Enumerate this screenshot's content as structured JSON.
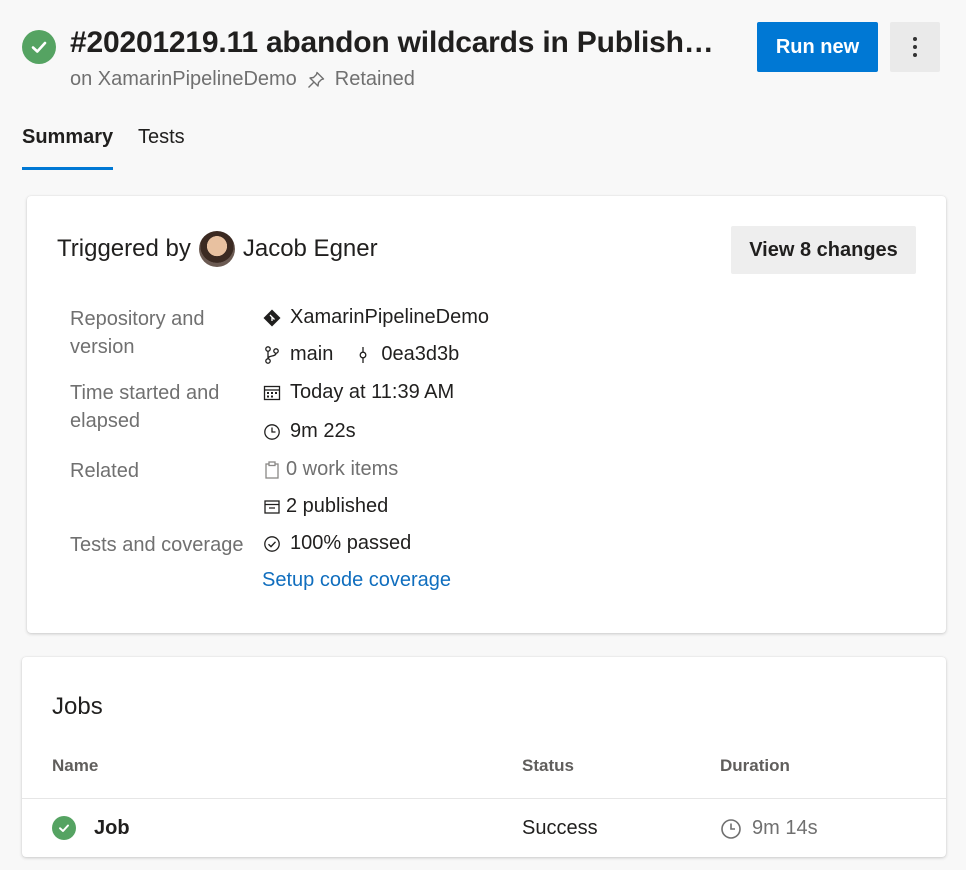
{
  "header": {
    "title": "#20201219.11 abandon wildcards in PublishBu…",
    "subtitle_prefix": "on XamarinPipelineDemo",
    "retained_label": "Retained",
    "run_new_label": "Run new"
  },
  "tabs": [
    {
      "label": "Summary",
      "selected": true
    },
    {
      "label": "Tests",
      "selected": false
    }
  ],
  "summary": {
    "triggered_prefix": "Triggered by",
    "user_name": "Jacob Egner",
    "view_changes_label": "View 8 changes",
    "repo_label": "Repository and version",
    "repo_name": "XamarinPipelineDemo",
    "branch": "main",
    "commit": "0ea3d3b",
    "time_label": "Time started and elapsed",
    "started": "Today at 11:39 AM",
    "elapsed": "9m 22s",
    "related_label": "Related",
    "work_items": "0 work items",
    "published": "2 published",
    "tests_label": "Tests and coverage",
    "tests_passed": "100% passed",
    "coverage_link": "Setup code coverage"
  },
  "jobs": {
    "title": "Jobs",
    "columns": [
      "Name",
      "Status",
      "Duration"
    ],
    "rows": [
      {
        "name": "Job",
        "status": "Success",
        "duration": "9m 14s"
      }
    ]
  },
  "colors": {
    "accent": "#0078d4",
    "success": "#55a362",
    "link": "#106ebe"
  }
}
